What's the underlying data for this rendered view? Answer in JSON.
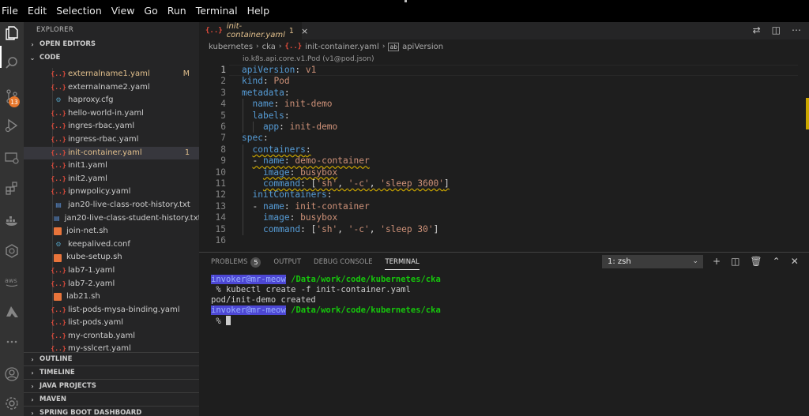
{
  "menubar": {
    "items": [
      "File",
      "Edit",
      "Selection",
      "View",
      "Go",
      "Run",
      "Terminal",
      "Help"
    ]
  },
  "activitybar": {
    "icons": [
      "files-icon",
      "search-icon",
      "source-control-icon",
      "run-debug-icon",
      "remote-explorer-icon",
      "extensions-icon",
      "docker-icon",
      "kubernetes-icon",
      "aws-icon",
      "azure-icon",
      "more-icon",
      "account-icon",
      "settings-gear-icon"
    ],
    "scm_badge": "13"
  },
  "sidebar": {
    "title": "EXPLORER",
    "open_editors": "OPEN EDITORS",
    "folder": "CODE",
    "files": [
      {
        "name": "externalname1.yaml",
        "type": "yaml",
        "badge": "M"
      },
      {
        "name": "externalname2.yaml",
        "type": "yaml",
        "badge": ""
      },
      {
        "name": "haproxy.cfg",
        "type": "gear",
        "badge": ""
      },
      {
        "name": "hello-world-in.yaml",
        "type": "yaml",
        "badge": ""
      },
      {
        "name": "ingres-rbac.yaml",
        "type": "yaml",
        "badge": ""
      },
      {
        "name": "ingress-rbac.yaml",
        "type": "yaml",
        "badge": ""
      },
      {
        "name": "init-container.yaml",
        "type": "yaml",
        "badge": "1"
      },
      {
        "name": "init1.yaml",
        "type": "yaml",
        "badge": ""
      },
      {
        "name": "init2.yaml",
        "type": "yaml",
        "badge": ""
      },
      {
        "name": "ipnwpolicy.yaml",
        "type": "yaml",
        "badge": ""
      },
      {
        "name": "jan20-live-class-root-history.txt",
        "type": "txt",
        "badge": ""
      },
      {
        "name": "jan20-live-class-student-history.txt",
        "type": "txt",
        "badge": ""
      },
      {
        "name": "join-net.sh",
        "type": "sh",
        "badge": ""
      },
      {
        "name": "keepalived.conf",
        "type": "gear",
        "badge": ""
      },
      {
        "name": "kube-setup.sh",
        "type": "sh",
        "badge": ""
      },
      {
        "name": "lab7-1.yaml",
        "type": "yaml",
        "badge": ""
      },
      {
        "name": "lab7-2.yaml",
        "type": "yaml",
        "badge": ""
      },
      {
        "name": "lab21.sh",
        "type": "sh",
        "badge": ""
      },
      {
        "name": "list-pods-mysa-binding.yaml",
        "type": "yaml",
        "badge": ""
      },
      {
        "name": "list-pods.yaml",
        "type": "yaml",
        "badge": ""
      },
      {
        "name": "my-crontab.yaml",
        "type": "yaml",
        "badge": ""
      },
      {
        "name": "my-sslcert.yaml",
        "type": "yaml",
        "badge": ""
      }
    ],
    "bottom_sections": [
      "OUTLINE",
      "TIMELINE",
      "JAVA PROJECTS",
      "MAVEN",
      "SPRING BOOT DASHBOARD"
    ]
  },
  "editor": {
    "tab": {
      "icon": "{..}",
      "label": "init-container.yaml",
      "badge": "1",
      "close": "×"
    },
    "breadcrumb": [
      "kubernetes",
      "cka",
      "init-container.yaml",
      "apiVersion"
    ],
    "breadcrumb_file_icon": "{..}",
    "breadcrumb_symbol_icon": "ab",
    "schema_hint": "io.k8s.api.core.v1.Pod (v1@pod.json)",
    "line_numbers": [
      "1",
      "2",
      "3",
      "4",
      "5",
      "6",
      "7",
      "8",
      "9",
      "10",
      "11",
      "12",
      "13",
      "14",
      "15",
      "16"
    ]
  },
  "panel": {
    "tabs": [
      "PROBLEMS",
      "OUTPUT",
      "DEBUG CONSOLE",
      "TERMINAL"
    ],
    "problems_count": "5",
    "terminal_select": "1: zsh",
    "terminal": {
      "user": "invoker@mr-meow",
      "path": "/Data/work/code/kubernetes/cka",
      "command": " % kubectl create -f init-container.yaml",
      "output": "pod/init-demo created",
      "prompt": " % "
    }
  }
}
